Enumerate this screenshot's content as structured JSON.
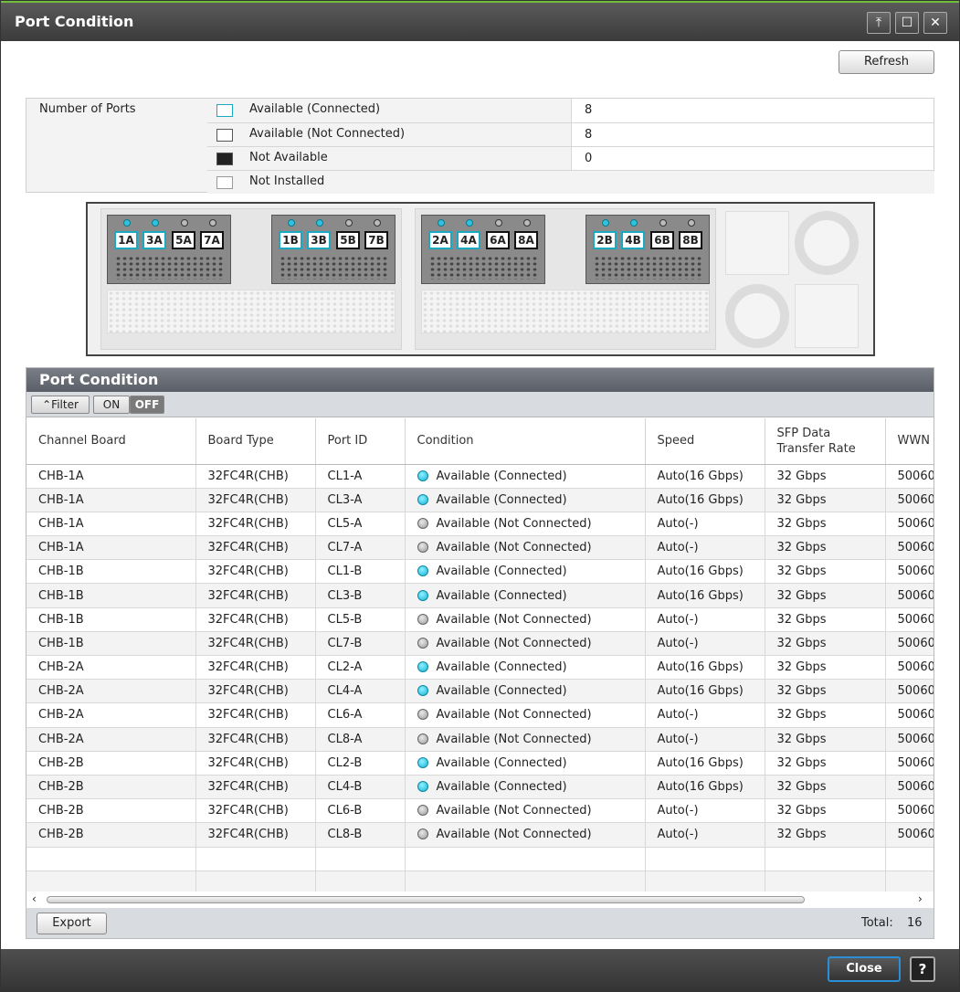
{
  "window": {
    "title": "Port Condition"
  },
  "toolbar": {
    "refresh": "Refresh"
  },
  "summary": {
    "label": "Number of Ports",
    "rows": [
      {
        "label": "Available (Connected)",
        "value": "8"
      },
      {
        "label": "Available (Not Connected)",
        "value": "8"
      },
      {
        "label": "Not Available",
        "value": "0"
      },
      {
        "label": "Not Installed",
        "value": ""
      }
    ]
  },
  "chassis": {
    "boards": [
      {
        "ports": [
          "1A",
          "3A",
          "5A",
          "7A"
        ],
        "connected": [
          true,
          true,
          false,
          false
        ]
      },
      {
        "ports": [
          "1B",
          "3B",
          "5B",
          "7B"
        ],
        "connected": [
          true,
          true,
          false,
          false
        ]
      },
      {
        "ports": [
          "2A",
          "4A",
          "6A",
          "8A"
        ],
        "connected": [
          true,
          true,
          false,
          false
        ]
      },
      {
        "ports": [
          "2B",
          "4B",
          "6B",
          "8B"
        ],
        "connected": [
          true,
          true,
          false,
          false
        ]
      }
    ]
  },
  "table": {
    "title": "Port Condition",
    "filter_label": "Filter",
    "on_label": "ON",
    "off_label": "OFF",
    "columns": [
      "Channel Board",
      "Board Type",
      "Port ID",
      "Condition",
      "Speed",
      "SFP Data Transfer Rate",
      "WWN"
    ],
    "rows": [
      [
        "CHB-1A",
        "32FC4R(CHB)",
        "CL1-A",
        "Available (Connected)",
        "Auto(16 Gbps)",
        "32 Gbps",
        "50060"
      ],
      [
        "CHB-1A",
        "32FC4R(CHB)",
        "CL3-A",
        "Available (Connected)",
        "Auto(16 Gbps)",
        "32 Gbps",
        "50060"
      ],
      [
        "CHB-1A",
        "32FC4R(CHB)",
        "CL5-A",
        "Available (Not Connected)",
        "Auto(-)",
        "32 Gbps",
        "50060"
      ],
      [
        "CHB-1A",
        "32FC4R(CHB)",
        "CL7-A",
        "Available (Not Connected)",
        "Auto(-)",
        "32 Gbps",
        "50060"
      ],
      [
        "CHB-1B",
        "32FC4R(CHB)",
        "CL1-B",
        "Available (Connected)",
        "Auto(16 Gbps)",
        "32 Gbps",
        "50060"
      ],
      [
        "CHB-1B",
        "32FC4R(CHB)",
        "CL3-B",
        "Available (Connected)",
        "Auto(16 Gbps)",
        "32 Gbps",
        "50060"
      ],
      [
        "CHB-1B",
        "32FC4R(CHB)",
        "CL5-B",
        "Available (Not Connected)",
        "Auto(-)",
        "32 Gbps",
        "50060"
      ],
      [
        "CHB-1B",
        "32FC4R(CHB)",
        "CL7-B",
        "Available (Not Connected)",
        "Auto(-)",
        "32 Gbps",
        "50060"
      ],
      [
        "CHB-2A",
        "32FC4R(CHB)",
        "CL2-A",
        "Available (Connected)",
        "Auto(16 Gbps)",
        "32 Gbps",
        "50060"
      ],
      [
        "CHB-2A",
        "32FC4R(CHB)",
        "CL4-A",
        "Available (Connected)",
        "Auto(16 Gbps)",
        "32 Gbps",
        "50060"
      ],
      [
        "CHB-2A",
        "32FC4R(CHB)",
        "CL6-A",
        "Available (Not Connected)",
        "Auto(-)",
        "32 Gbps",
        "50060"
      ],
      [
        "CHB-2A",
        "32FC4R(CHB)",
        "CL8-A",
        "Available (Not Connected)",
        "Auto(-)",
        "32 Gbps",
        "50060"
      ],
      [
        "CHB-2B",
        "32FC4R(CHB)",
        "CL2-B",
        "Available (Connected)",
        "Auto(16 Gbps)",
        "32 Gbps",
        "50060"
      ],
      [
        "CHB-2B",
        "32FC4R(CHB)",
        "CL4-B",
        "Available (Connected)",
        "Auto(16 Gbps)",
        "32 Gbps",
        "50060"
      ],
      [
        "CHB-2B",
        "32FC4R(CHB)",
        "CL6-B",
        "Available (Not Connected)",
        "Auto(-)",
        "32 Gbps",
        "50060"
      ],
      [
        "CHB-2B",
        "32FC4R(CHB)",
        "CL8-B",
        "Available (Not Connected)",
        "Auto(-)",
        "32 Gbps",
        "50060"
      ]
    ],
    "export": "Export",
    "total_label": "Total:",
    "total_value": "16"
  },
  "footer": {
    "close": "Close",
    "help": "?"
  },
  "colors": {
    "connected": "#16b4d6",
    "not_connected": "#9a9a9a",
    "titlebar": "#3b3b3b",
    "accent": "#6fbf3a"
  }
}
